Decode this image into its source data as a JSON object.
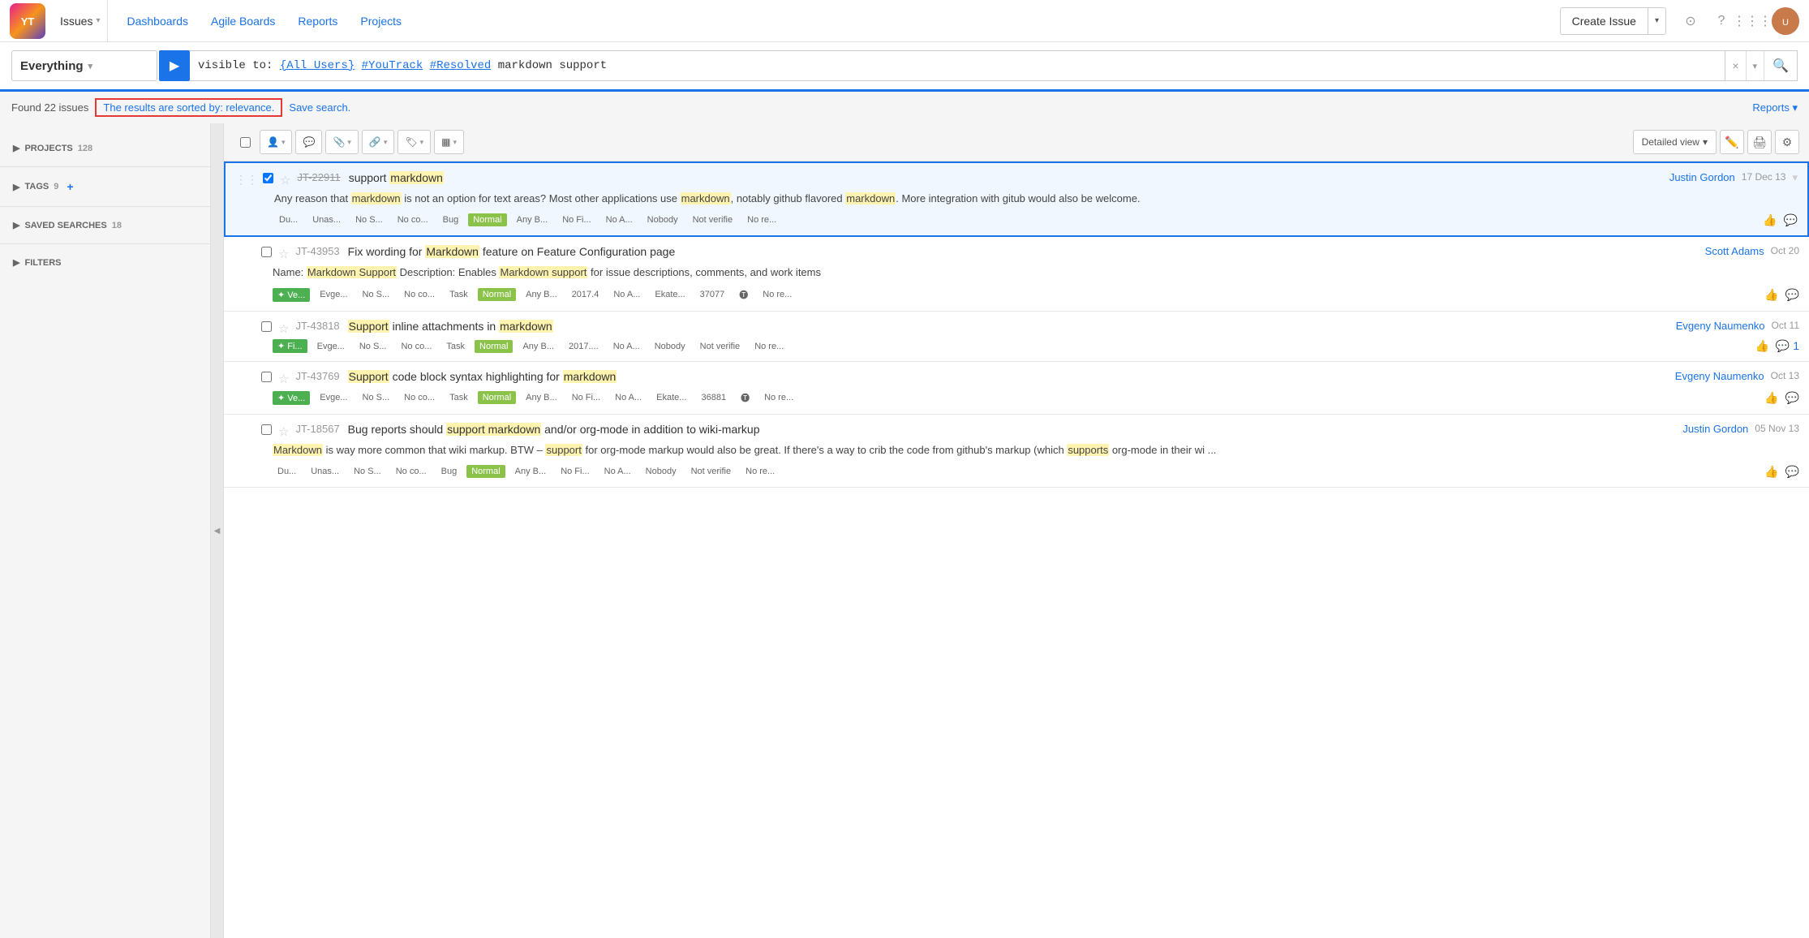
{
  "app": {
    "logo_text": "YT",
    "nav": {
      "issues_label": "Issues",
      "dashboards_label": "Dashboards",
      "agile_boards_label": "Agile Boards",
      "reports_label": "Reports",
      "projects_label": "Projects",
      "create_issue_label": "Create Issue"
    }
  },
  "search": {
    "project_label": "Everything",
    "query": "visible to: {All Users} #YouTrack #Resolved markdown support",
    "clear_label": "×",
    "results_text": "Found 22 issues",
    "sorted_by_text": "The results are sorted by: relevance.",
    "save_search_text": "Save search.",
    "reports_link": "Reports ▾"
  },
  "sidebar": {
    "projects_label": "PROJECTS",
    "projects_count": "128",
    "tags_label": "TAGS",
    "tags_count": "9",
    "saved_searches_label": "SAVED SEARCHES",
    "saved_searches_count": "18",
    "filters_label": "FILTERS"
  },
  "toolbar": {
    "detailed_view_label": "Detailed view",
    "detailed_view_arrow": "▾"
  },
  "issues": [
    {
      "id": "JT-22911",
      "id_strikethrough": true,
      "title_parts": [
        "support ",
        "markdown"
      ],
      "title_highlights": [
        1
      ],
      "author": "Justin Gordon",
      "date": "17 Dec 13",
      "body_parts": [
        "Any reason that ",
        "markdown",
        " is not an option for text areas? Most other applications use ",
        "markdown",
        ", notably github flavored ",
        "markdown",
        ". More integration with gitub would also be welcome."
      ],
      "body_highlights": [
        1,
        3,
        5
      ],
      "meta": [
        "Du...",
        "Unas...",
        "No S...",
        "No co...",
        "Bug",
        "Normal",
        "Any B...",
        "No Fi...",
        "No A...",
        "Nobody",
        "Not verifie",
        "No re..."
      ],
      "priority": "Normal",
      "tag": null,
      "selected": true
    },
    {
      "id": "JT-43953",
      "id_strikethrough": false,
      "title_parts": [
        "Fix wording for ",
        "Markdown",
        " feature on Feature Configuration page"
      ],
      "title_highlights": [
        1
      ],
      "author": "Scott Adams",
      "date": "Oct 20",
      "body_parts": [
        "Name: ",
        "Markdown Support",
        " Description: Enables ",
        "Markdown support",
        " for issue descriptions, comments, and work items"
      ],
      "body_highlights": [
        1,
        3
      ],
      "meta": [
        "Evge...",
        "No S...",
        "No co...",
        "Task",
        "Normal",
        "Any B...",
        "2017.4",
        "No A...",
        "Ekate...",
        "37077",
        "No re..."
      ],
      "priority": "Normal",
      "tag": "Ve...",
      "tag_color": "green",
      "selected": false
    },
    {
      "id": "JT-43818",
      "id_strikethrough": false,
      "title_parts": [
        "Support",
        " inline attachments in ",
        "markdown"
      ],
      "title_highlights": [
        0,
        2
      ],
      "author": "Evgeny Naumenko",
      "date": "Oct 11",
      "body_parts": [],
      "body_highlights": [],
      "meta": [
        "Evge...",
        "No S...",
        "No co...",
        "Task",
        "Normal",
        "Any B...",
        "2017....",
        "No A...",
        "Nobody",
        "Not verifie",
        "No re..."
      ],
      "priority": "Normal",
      "tag": "Fi...",
      "tag_color": "green",
      "selected": false,
      "comment_count": "1"
    },
    {
      "id": "JT-43769",
      "id_strikethrough": false,
      "title_parts": [
        "Support",
        " code block syntax highlighting for ",
        "markdown"
      ],
      "title_highlights": [
        0,
        2
      ],
      "author": "Evgeny Naumenko",
      "date": "Oct 13",
      "body_parts": [],
      "body_highlights": [],
      "meta": [
        "Evge...",
        "No S...",
        "No co...",
        "Task",
        "Normal",
        "Any B...",
        "No Fi...",
        "No A...",
        "Ekate...",
        "36881",
        "No re..."
      ],
      "priority": "Normal",
      "tag": "Ve...",
      "tag_color": "green",
      "selected": false
    },
    {
      "id": "JT-18567",
      "id_strikethrough": false,
      "title_parts": [
        "Bug reports should ",
        "support markdown",
        " and/or org-mode in addition to wiki-markup"
      ],
      "title_highlights": [
        1
      ],
      "author": "Justin Gordon",
      "date": "05 Nov 13",
      "body_parts": [
        "Markdown",
        " is way more common that wiki markup. BTW &ndash; ",
        "support",
        " for org-mode markup would also be great. If there's a way to crib the code from github's markup (which ",
        "supports",
        " org-mode in their wi ..."
      ],
      "body_highlights": [
        0,
        2,
        4
      ],
      "meta": [
        "Du...",
        "Unas...",
        "No S...",
        "No co...",
        "Bug",
        "Normal",
        "Any B...",
        "No Fi...",
        "No A...",
        "Nobody",
        "Not verifie",
        "No re..."
      ],
      "priority": "Normal",
      "tag": null,
      "selected": false
    }
  ]
}
